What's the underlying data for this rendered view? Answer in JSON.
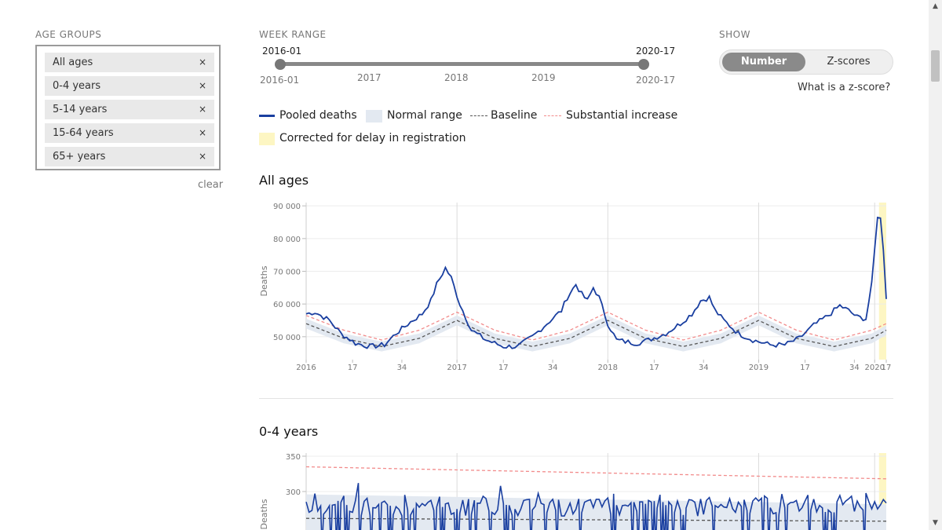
{
  "age_groups": {
    "heading": "AGE GROUPS",
    "items": [
      {
        "label": "All ages"
      },
      {
        "label": "0-4 years"
      },
      {
        "label": "5-14 years"
      },
      {
        "label": "15-64 years"
      },
      {
        "label": "65+ years"
      }
    ],
    "remove_glyph": "×",
    "clear_label": "clear"
  },
  "week_range": {
    "heading": "WEEK RANGE",
    "start_value": "2016-01",
    "end_value": "2020-17",
    "start_label": "2016-01",
    "end_label": "2020-17",
    "ticks": [
      "2017",
      "2018",
      "2019"
    ]
  },
  "show": {
    "heading": "SHOW",
    "options": [
      "Number",
      "Z-scores"
    ],
    "selected": "Number",
    "zscore_link": "What is a z-score?"
  },
  "legend": {
    "pooled": "Pooled deaths",
    "normal": "Normal range",
    "baseline": "Baseline",
    "substantial": "Substantial increase",
    "corrected": "Corrected for delay in registration"
  },
  "colors": {
    "pooled": "#1a3fa0",
    "normal": "#e3e9f1",
    "baseline": "#555555",
    "substantial": "#f28b8b",
    "corrected": "#fdf6c3"
  },
  "icons": {
    "remove": "close-icon",
    "scroll_up": "triangle-up-icon",
    "scroll_down": "triangle-down-icon"
  },
  "chart_data": [
    {
      "type": "line",
      "title": "All ages",
      "ylabel": "Deaths",
      "ylim": [
        43000,
        91000
      ],
      "yticks": [
        50000,
        60000,
        70000,
        80000,
        90000
      ],
      "ytick_labels": [
        "50 000",
        "60 000",
        "70 000",
        "80 000",
        "90 000"
      ],
      "xrange_weeks": [
        "2016-01",
        "2020-17"
      ],
      "xtick_labels": [
        "2016",
        "17",
        "34",
        "2017",
        "17",
        "34",
        "2018",
        "17",
        "34",
        "2019",
        "17",
        "34",
        "2020",
        "17"
      ],
      "year_gridlines": [
        "2017",
        "2018",
        "2019",
        "2020"
      ],
      "corrected_weeks": [
        "2020-15",
        "2020-17"
      ],
      "series": [
        {
          "name": "Pooled deaths",
          "keypoints": [
            [
              0,
              57000
            ],
            [
              3,
              57500
            ],
            [
              8,
              55000
            ],
            [
              12,
              51000
            ],
            [
              17,
              48000
            ],
            [
              22,
              47000
            ],
            [
              27,
              47500
            ],
            [
              31,
              51000
            ],
            [
              36,
              54500
            ],
            [
              40,
              57000
            ],
            [
              43,
              61000
            ],
            [
              45,
              66000
            ],
            [
              48,
              71000
            ],
            [
              50,
              68000
            ],
            [
              53,
              60000
            ],
            [
              57,
              52000
            ],
            [
              62,
              49000
            ],
            [
              68,
              47000
            ],
            [
              73,
              47000
            ],
            [
              78,
              50000
            ],
            [
              83,
              54000
            ],
            [
              88,
              58000
            ],
            [
              90,
              62000
            ],
            [
              93,
              66000
            ],
            [
              95,
              63000
            ],
            [
              97,
              61000
            ],
            [
              99,
              65000
            ],
            [
              101,
              62000
            ],
            [
              104,
              54000
            ],
            [
              107,
              49000
            ],
            [
              110,
              48500
            ],
            [
              114,
              48000
            ],
            [
              118,
              49000
            ],
            [
              124,
              51000
            ],
            [
              129,
              54000
            ],
            [
              133,
              57000
            ],
            [
              136,
              61000
            ],
            [
              139,
              62000
            ],
            [
              141,
              58000
            ],
            [
              144,
              55000
            ],
            [
              149,
              51000
            ],
            [
              154,
              49000
            ],
            [
              160,
              47500
            ],
            [
              165,
              47500
            ],
            [
              170,
              49500
            ],
            [
              175,
              53500
            ],
            [
              180,
              56500
            ],
            [
              184,
              59500
            ],
            [
              187,
              58000
            ],
            [
              190,
              56000
            ],
            [
              193,
              55500
            ],
            [
              195,
              66000
            ],
            [
              197,
              87000
            ],
            [
              198,
              86000
            ],
            [
              199,
              77000
            ],
            [
              200,
              62000
            ]
          ]
        },
        {
          "name": "Baseline",
          "keypoints": [
            [
              0,
              54000
            ],
            [
              13,
              49500
            ],
            [
              26,
              47000
            ],
            [
              39,
              49500
            ],
            [
              52,
              55000
            ],
            [
              65,
              49500
            ],
            [
              78,
              47000
            ],
            [
              91,
              49500
            ],
            [
              104,
              55000
            ],
            [
              117,
              49500
            ],
            [
              130,
              47000
            ],
            [
              143,
              49500
            ],
            [
              156,
              55000
            ],
            [
              169,
              49500
            ],
            [
              182,
              47000
            ],
            [
              195,
              49500
            ],
            [
              200,
              52000
            ]
          ]
        },
        {
          "name": "Substantial increase",
          "keypoints": [
            [
              0,
              56500
            ],
            [
              13,
              52000
            ],
            [
              26,
              49000
            ],
            [
              39,
              52000
            ],
            [
              52,
              57500
            ],
            [
              65,
              52000
            ],
            [
              78,
              49000
            ],
            [
              91,
              52000
            ],
            [
              104,
              57500
            ],
            [
              117,
              52000
            ],
            [
              130,
              49000
            ],
            [
              143,
              52000
            ],
            [
              156,
              57500
            ],
            [
              169,
              52000
            ],
            [
              182,
              49000
            ],
            [
              195,
              52000
            ],
            [
              200,
              54000
            ]
          ]
        }
      ]
    },
    {
      "type": "line",
      "title": "0-4 years",
      "ylabel": "Deaths",
      "ylim": [
        240,
        360
      ],
      "yticks": [
        300,
        350
      ],
      "ytick_labels": [
        "300",
        "350"
      ],
      "series": [
        {
          "name": "Baseline",
          "values_start_end": [
            262,
            258
          ]
        },
        {
          "name": "Substantial increase",
          "values_start_end": [
            335,
            318
          ]
        }
      ],
      "normal_range_upper_start_end": [
        296,
        282
      ]
    }
  ]
}
